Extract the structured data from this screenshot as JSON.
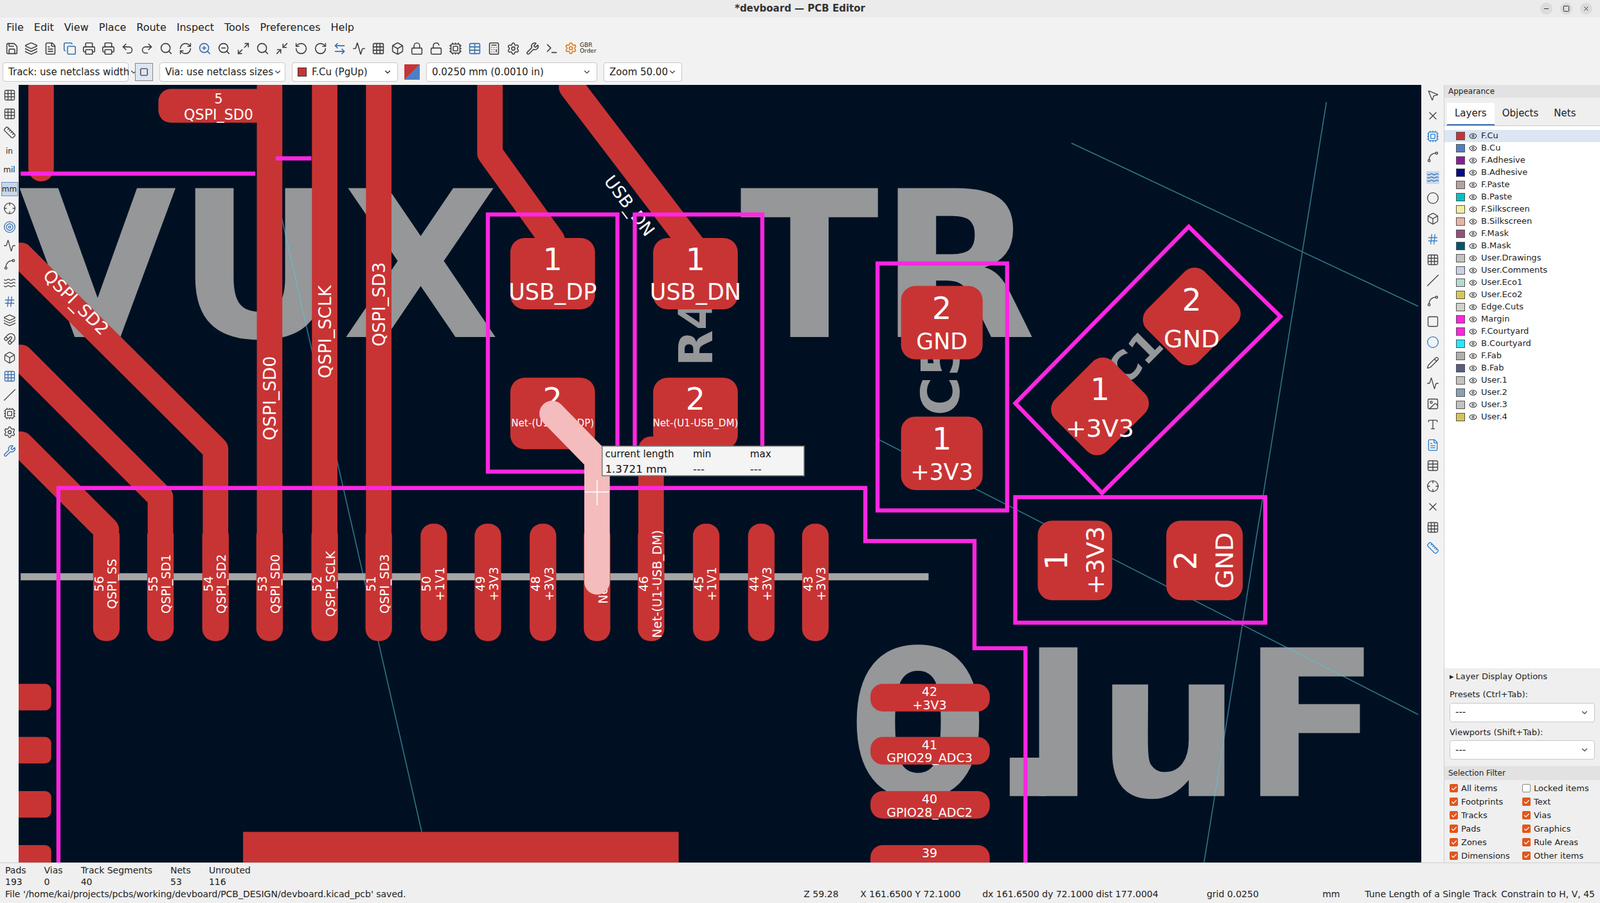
{
  "window": {
    "title": "*devboard — PCB Editor"
  },
  "menu": [
    "File",
    "Edit",
    "View",
    "Place",
    "Route",
    "Inspect",
    "Tools",
    "Preferences",
    "Help"
  ],
  "toolbar": {
    "gbr": [
      "GBR",
      "Order"
    ]
  },
  "options_bar": {
    "track": "Track: use netclass width",
    "via": "Via: use netclass sizes",
    "layer": "F.Cu (PgUp)",
    "grid": "0.0250 mm (0.0010 in)",
    "zoom": "Zoom 50.00"
  },
  "left_toolbar": {
    "units": [
      {
        "label": "in",
        "selected": false
      },
      {
        "label": "mil",
        "selected": false
      },
      {
        "label": "mm",
        "selected": true
      }
    ]
  },
  "canvas": {
    "top_pad": {
      "number": "5",
      "net": "QSPI_SD0"
    },
    "track_labels": [
      "QSPI_SD2",
      "QSPI_SD0",
      "QSPI_SCLK",
      "QSPI_SD3",
      "USB_DN"
    ],
    "pads": [
      {
        "number": "1",
        "net": "USB_DP",
        "kind": "upright"
      },
      {
        "number": "2",
        "net": "Net-(U1-USB_DP)",
        "kind": "upright"
      },
      {
        "number": "1",
        "net": "USB_DN",
        "kind": "upright"
      },
      {
        "number": "2",
        "net": "Net-(U1-USB_DM)",
        "kind": "upright"
      },
      {
        "number": "2",
        "net": "GND",
        "kind": "upright"
      },
      {
        "number": "1",
        "net": "+3V3",
        "kind": "upright"
      },
      {
        "number": "2",
        "net": "GND",
        "kind": "diagonal"
      },
      {
        "number": "1",
        "net": "+3V3",
        "kind": "diagonal"
      },
      {
        "number": "1",
        "net": "+3V3",
        "kind": "vertical"
      },
      {
        "number": "2",
        "net": "GND",
        "kind": "vertical"
      }
    ],
    "u1_pins": [
      {
        "number": "56",
        "net": "QSPI_SS"
      },
      {
        "number": "55",
        "net": "QSPI_SD1"
      },
      {
        "number": "54",
        "net": "QSPI_SD2"
      },
      {
        "number": "53",
        "net": "QSPI_SD0"
      },
      {
        "number": "52",
        "net": "QSPI_SCLK"
      },
      {
        "number": "51",
        "net": "QSPI_SD3"
      },
      {
        "number": "50",
        "net": "+1V1"
      },
      {
        "number": "49",
        "net": "+3V3"
      },
      {
        "number": "48",
        "net": "+3V3"
      },
      {
        "number": "",
        "net": "Net-(U"
      },
      {
        "number": "46",
        "net": "Net-(U1-USB_DM)"
      },
      {
        "number": "45",
        "net": "+1V1"
      },
      {
        "number": "44",
        "net": "+3V3"
      },
      {
        "number": "43",
        "net": "+3V3"
      }
    ],
    "side_pins": [
      {
        "number": "42",
        "net": "+3V3"
      },
      {
        "number": "41",
        "net": "GPIO29_ADC3"
      },
      {
        "number": "40",
        "net": "GPIO28_ADC2"
      },
      {
        "number": "39",
        "net": ""
      }
    ],
    "silkscreen": [
      "VUX",
      "TR",
      "0.",
      "IuF",
      "C5",
      "R4",
      "C1"
    ],
    "tooltip": {
      "headers": [
        "current length",
        "min",
        "max"
      ],
      "values": [
        "1.3721 mm",
        "---",
        "---"
      ]
    }
  },
  "appearance": {
    "title": "Appearance",
    "tabs": [
      {
        "label": "Layers",
        "selected": true
      },
      {
        "label": "Objects",
        "selected": false
      },
      {
        "label": "Nets",
        "selected": false
      }
    ],
    "layers": [
      {
        "name": "F.Cu",
        "color": "#c83434",
        "selected": true
      },
      {
        "name": "B.Cu",
        "color": "#4d7fc4",
        "selected": false
      },
      {
        "name": "F.Adhesive",
        "color": "#8b1c9a",
        "selected": false
      },
      {
        "name": "B.Adhesive",
        "color": "#0a0a8c",
        "selected": false
      },
      {
        "name": "F.Paste",
        "color": "#b5a0a0",
        "selected": false
      },
      {
        "name": "B.Paste",
        "color": "#00c2c2",
        "selected": false
      },
      {
        "name": "F.Silkscreen",
        "color": "#f2eda1",
        "selected": false
      },
      {
        "name": "B.Silkscreen",
        "color": "#e8b2a7",
        "selected": false
      },
      {
        "name": "F.Mask",
        "color": "#91537a",
        "selected": false
      },
      {
        "name": "B.Mask",
        "color": "#02556e",
        "selected": false
      },
      {
        "name": "User.Drawings",
        "color": "#c2c2c2",
        "selected": false
      },
      {
        "name": "User.Comments",
        "color": "#c9cfe8",
        "selected": false
      },
      {
        "name": "User.Eco1",
        "color": "#b4dbd2",
        "selected": false
      },
      {
        "name": "User.Eco2",
        "color": "#d8c852",
        "selected": false
      },
      {
        "name": "Edge.Cuts",
        "color": "#d0d2cd",
        "selected": false
      },
      {
        "name": "Margin",
        "color": "#ff26e2",
        "selected": false
      },
      {
        "name": "F.Courtyard",
        "color": "#ff26e2",
        "selected": false
      },
      {
        "name": "B.Courtyard",
        "color": "#26e9ff",
        "selected": false
      },
      {
        "name": "F.Fab",
        "color": "#afafaf",
        "selected": false
      },
      {
        "name": "B.Fab",
        "color": "#585d84",
        "selected": false
      },
      {
        "name": "User.1",
        "color": "#c2c2c2",
        "selected": false
      },
      {
        "name": "User.2",
        "color": "#89a0b4",
        "selected": false
      },
      {
        "name": "User.3",
        "color": "#c2c2c2",
        "selected": false
      },
      {
        "name": "User.4",
        "color": "#d3c456",
        "selected": false
      }
    ],
    "display_options": {
      "icon": "▸",
      "label": "Layer Display Options",
      "expanded": false
    },
    "presets": {
      "label": "Presets (Ctrl+Tab):",
      "value": "---"
    },
    "viewports": {
      "label": "Viewports (Shift+Tab):",
      "value": "---"
    },
    "selection_filter": {
      "title": "Selection Filter",
      "items": [
        {
          "label": "All items",
          "checked": true
        },
        {
          "label": "Locked items",
          "checked": false
        },
        {
          "label": "Footprints",
          "checked": true
        },
        {
          "label": "Text",
          "checked": true
        },
        {
          "label": "Tracks",
          "checked": true
        },
        {
          "label": "Vias",
          "checked": true
        },
        {
          "label": "Pads",
          "checked": true
        },
        {
          "label": "Graphics",
          "checked": true
        },
        {
          "label": "Zones",
          "checked": true
        },
        {
          "label": "Rule Areas",
          "checked": true
        },
        {
          "label": "Dimensions",
          "checked": true
        },
        {
          "label": "Other items",
          "checked": true
        }
      ]
    }
  },
  "status_bar": {
    "stats": [
      {
        "label": "Pads",
        "value": "193"
      },
      {
        "label": "Vias",
        "value": "0"
      },
      {
        "label": "Track Segments",
        "value": "40"
      },
      {
        "label": "Nets",
        "value": "53"
      },
      {
        "label": "Unrouted",
        "value": "116"
      }
    ],
    "message": "File '/home/kai/projects/pcbs/working/devboard/PCB_DESIGN/devboard.kicad_pcb' saved.",
    "zoom": "Z 59.28",
    "position": "X 161.6500 Y 72.1000",
    "delta": "dx 161.6500 dy 72.1000 dist 177.0004",
    "grid": "grid 0.0250",
    "units": "mm",
    "tool": "Tune Length of a Single Track",
    "constraint": "Constrain to H, V, 45"
  }
}
